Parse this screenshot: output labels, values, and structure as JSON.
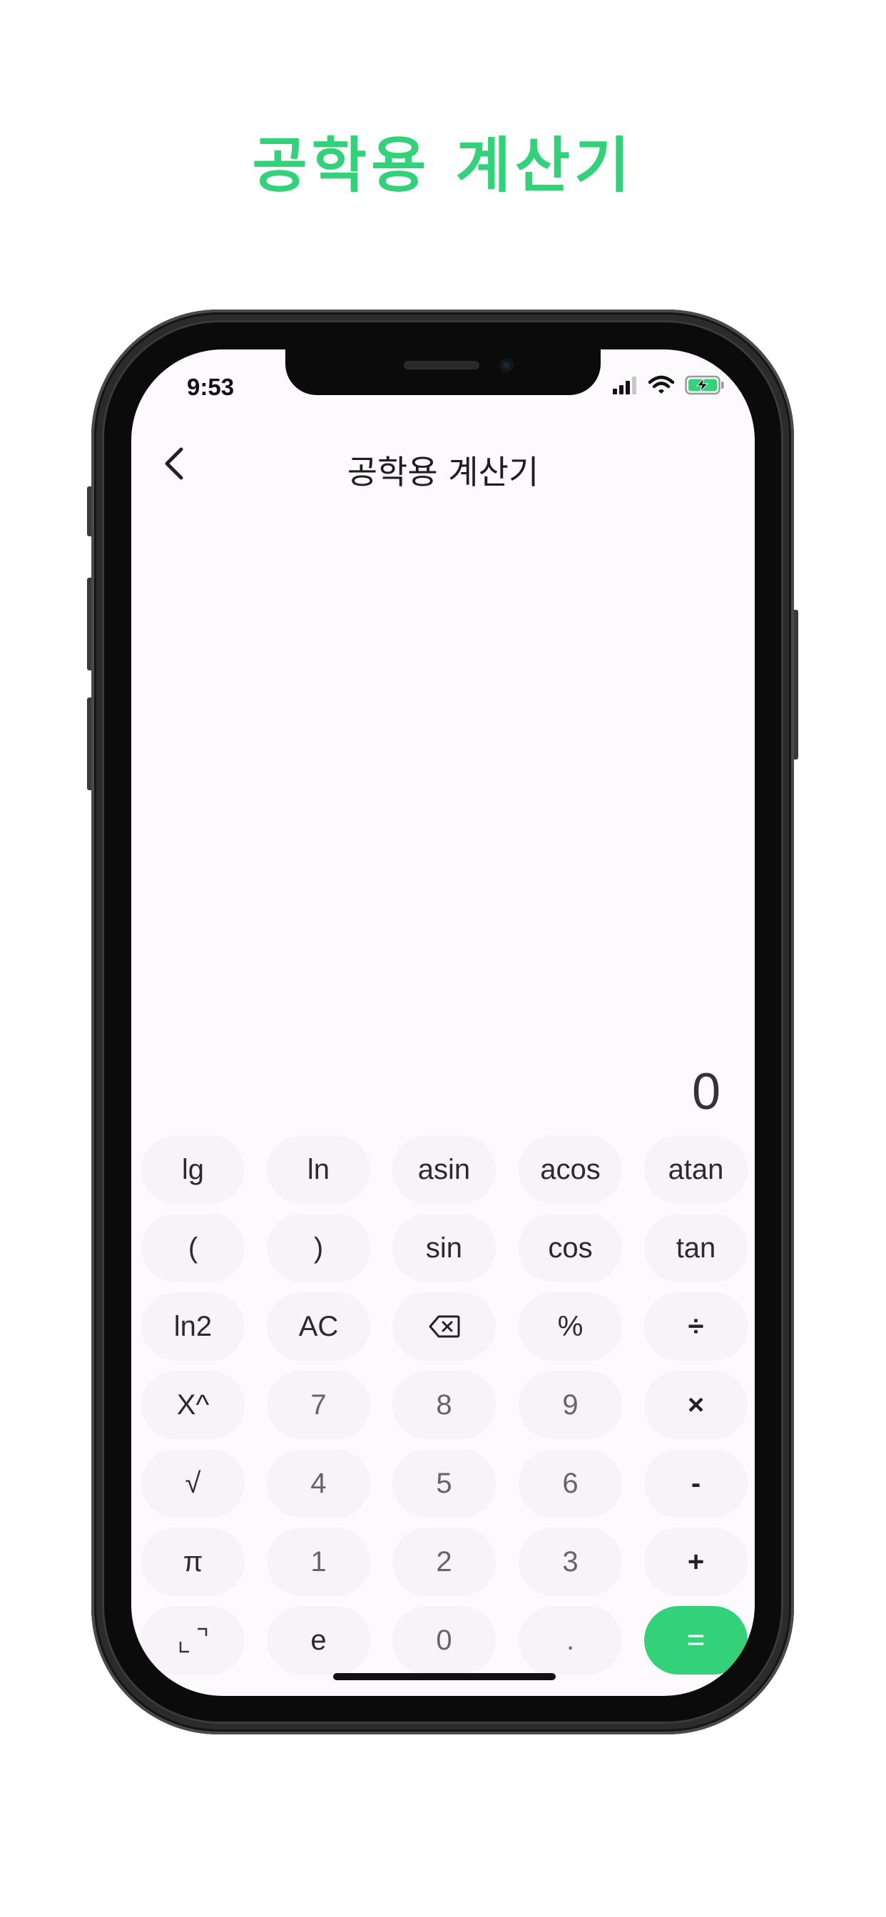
{
  "promo": {
    "title": "공학용 계산기"
  },
  "status_bar": {
    "time": "9:53"
  },
  "nav": {
    "back_icon": "chevron-left",
    "title": "공학용 계산기"
  },
  "display": {
    "value": "0"
  },
  "colors": {
    "accent": "#33d17a",
    "screen_bg": "#fcfafc",
    "key_bg": "#f7f4f7"
  },
  "keypad": {
    "rows": [
      [
        {
          "label": "lg",
          "kind": "func"
        },
        {
          "label": "ln",
          "kind": "func"
        },
        {
          "label": "asin",
          "kind": "func"
        },
        {
          "label": "acos",
          "kind": "func"
        },
        {
          "label": "atan",
          "kind": "func"
        }
      ],
      [
        {
          "label": "(",
          "kind": "func"
        },
        {
          "label": ")",
          "kind": "func"
        },
        {
          "label": "sin",
          "kind": "func"
        },
        {
          "label": "cos",
          "kind": "func"
        },
        {
          "label": "tan",
          "kind": "func"
        }
      ],
      [
        {
          "label": "ln2",
          "kind": "func"
        },
        {
          "label": "AC",
          "kind": "func"
        },
        {
          "label": "",
          "kind": "backspace",
          "icon": "backspace-icon"
        },
        {
          "label": "%",
          "kind": "func"
        },
        {
          "label": "÷",
          "kind": "op"
        }
      ],
      [
        {
          "label": "X^",
          "kind": "func"
        },
        {
          "label": "7",
          "kind": "num"
        },
        {
          "label": "8",
          "kind": "num"
        },
        {
          "label": "9",
          "kind": "num"
        },
        {
          "label": "×",
          "kind": "op"
        }
      ],
      [
        {
          "label": "√",
          "kind": "func"
        },
        {
          "label": "4",
          "kind": "num"
        },
        {
          "label": "5",
          "kind": "num"
        },
        {
          "label": "6",
          "kind": "num"
        },
        {
          "label": "-",
          "kind": "op"
        }
      ],
      [
        {
          "label": "π",
          "kind": "func"
        },
        {
          "label": "1",
          "kind": "num"
        },
        {
          "label": "2",
          "kind": "num"
        },
        {
          "label": "3",
          "kind": "num"
        },
        {
          "label": "+",
          "kind": "op"
        }
      ],
      [
        {
          "label": "",
          "kind": "expand",
          "icon": "expand-icon"
        },
        {
          "label": "e",
          "kind": "func"
        },
        {
          "label": "0",
          "kind": "num"
        },
        {
          "label": ".",
          "kind": "num"
        },
        {
          "label": "=",
          "kind": "eq"
        }
      ]
    ]
  }
}
